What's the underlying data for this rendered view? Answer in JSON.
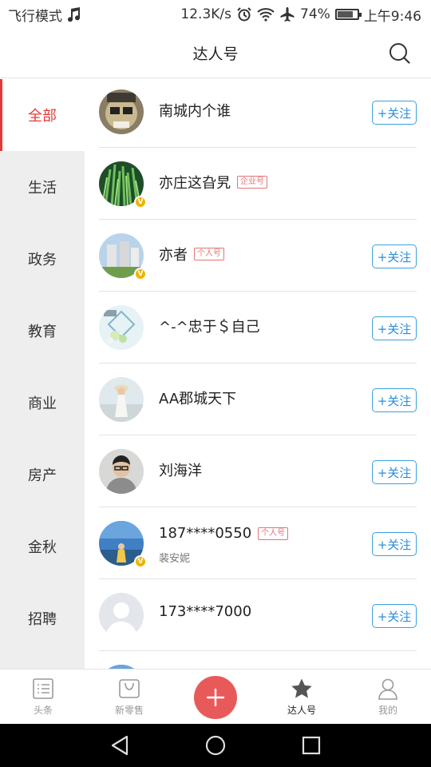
{
  "status_bar": {
    "left": "飞行模式",
    "net_speed": "12.3K/s",
    "battery": "74%",
    "battery_level": 0.74,
    "time": "上午9:46",
    "icons": [
      "music-note-icon",
      "alarm-icon",
      "wifi-icon",
      "airplane-icon",
      "battery-icon"
    ]
  },
  "header": {
    "title": "达人号",
    "search_icon": "search-icon"
  },
  "sidebar": {
    "active_index": 0,
    "categories": [
      "全部",
      "生活",
      "政务",
      "教育",
      "商业",
      "房产",
      "金秋",
      "招聘"
    ],
    "accent": "#e53935"
  },
  "list": {
    "follow_label": "+关注",
    "items": [
      {
        "name": "南城内个谁",
        "tag": "",
        "sub": "",
        "verified": false,
        "follow": true,
        "avatar": "cartoon-face"
      },
      {
        "name": "亦庄这旮旯",
        "tag": "企业号",
        "sub": "",
        "verified": true,
        "follow": false,
        "avatar": "green-grass"
      },
      {
        "name": "亦者",
        "tag": "个人号",
        "sub": "",
        "verified": true,
        "follow": true,
        "avatar": "buildings"
      },
      {
        "name": "^-^忠于＄自己",
        "tag": "",
        "sub": "",
        "verified": false,
        "follow": true,
        "avatar": "diamond-flowers"
      },
      {
        "name": "AA郡城天下",
        "tag": "",
        "sub": "",
        "verified": false,
        "follow": true,
        "avatar": "girl-beach"
      },
      {
        "name": "刘海洋",
        "tag": "",
        "sub": "",
        "verified": false,
        "follow": true,
        "avatar": "boy-glasses"
      },
      {
        "name": "187****0550",
        "tag": "个人号",
        "sub": "裴安妮",
        "verified": true,
        "follow": true,
        "avatar": "sky-landscape"
      },
      {
        "name": "173****7000",
        "tag": "",
        "sub": "",
        "verified": false,
        "follow": true,
        "avatar": "default-person"
      },
      {
        "name": "",
        "tag": "",
        "sub": "",
        "verified": false,
        "follow": true,
        "avatar": "sky-landscape"
      }
    ]
  },
  "tab_bar": {
    "active_index": 3,
    "tabs": [
      {
        "label": "头条",
        "icon": "list-icon"
      },
      {
        "label": "新零售",
        "icon": "shopping-bag-icon"
      },
      {
        "label": "",
        "icon": "plus-icon"
      },
      {
        "label": "达人号",
        "icon": "star-icon"
      },
      {
        "label": "我的",
        "icon": "person-icon"
      }
    ],
    "plus_color": "#e85a5a"
  },
  "nav_bar": {
    "buttons": [
      "back-icon",
      "home-icon",
      "recents-icon"
    ]
  }
}
